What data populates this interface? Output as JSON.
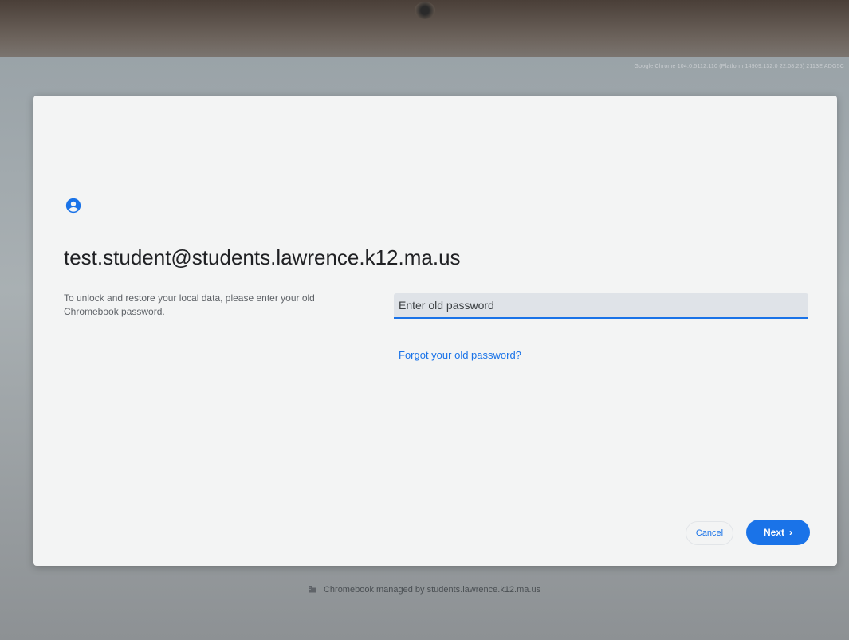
{
  "system": {
    "version_text": "Google Chrome 104.0.5112.110 (Platform 14909.132.0 22.08.25) 2113E ADG5C"
  },
  "dialog": {
    "avatar_icon": "account-circle-icon",
    "email": "test.student@students.lawrence.k12.ma.us",
    "description": "To unlock and restore your local data, please enter your old Chromebook password.",
    "password_field": {
      "placeholder": "Enter old password",
      "value": ""
    },
    "forgot_link": "Forgot your old password?",
    "cancel_label": "Cancel",
    "next_label": "Next",
    "next_icon": "chevron-right-icon",
    "accent_color": "#1a73e8"
  },
  "footer": {
    "icon": "building-icon",
    "text": "Chromebook managed by students.lawrence.k12.ma.us"
  }
}
